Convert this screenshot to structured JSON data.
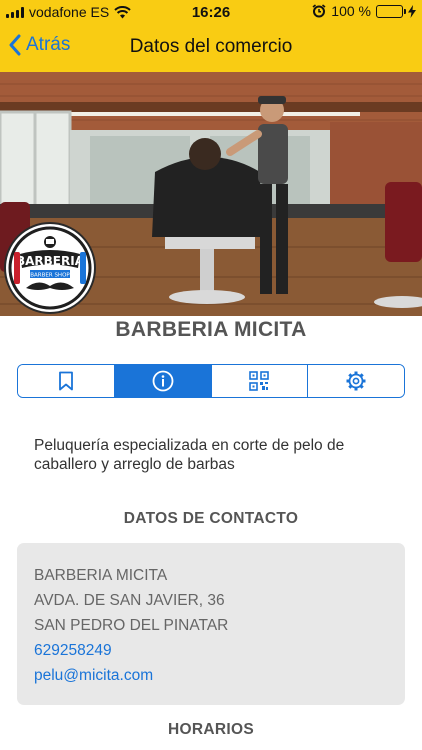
{
  "status_bar": {
    "carrier": "vodafone ES",
    "time": "16:26",
    "battery": "100 %",
    "battery_level": 1.0
  },
  "nav": {
    "back_label": "Atrás",
    "title": "Datos del comercio"
  },
  "logo": {
    "brand": "BARBERIA",
    "tagline": "BARBER SHOP"
  },
  "shop": {
    "name": "BARBERIA MICITA",
    "description": "Peluquería especializada en corte de pelo de caballero y arreglo de barbas"
  },
  "tabs": [
    {
      "icon": "bookmark-icon",
      "active": false
    },
    {
      "icon": "info-icon",
      "active": true
    },
    {
      "icon": "qr-code-icon",
      "active": false
    },
    {
      "icon": "gear-icon",
      "active": false
    }
  ],
  "contact": {
    "section_title": "DATOS DE CONTACTO",
    "name": "BARBERIA MICITA",
    "address": "AVDA. DE SAN JAVIER, 36",
    "city": "SAN PEDRO DEL PINATAR",
    "phone": "629258249",
    "email": "pelu@micita.com"
  },
  "schedule": {
    "section_title": "HORARIOS"
  },
  "colors": {
    "topbar": "#f9cc13",
    "accent": "#1a74d8",
    "card_bg": "#e8e8e8"
  }
}
